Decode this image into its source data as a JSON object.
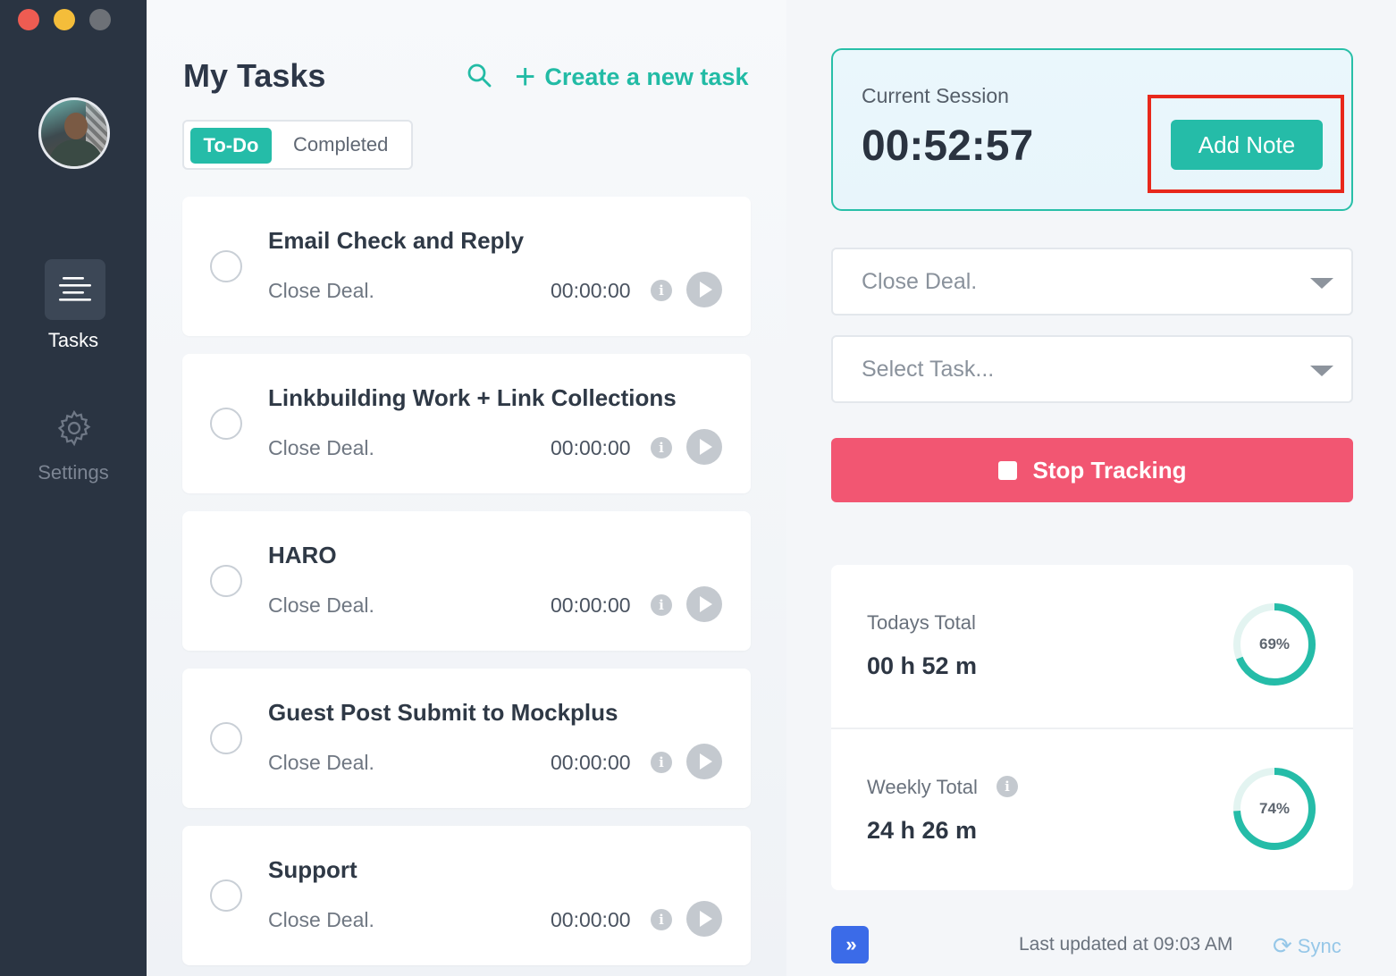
{
  "sidebar": {
    "nav": [
      {
        "label": "Tasks",
        "icon": "list-icon",
        "active": true
      },
      {
        "label": "Settings",
        "icon": "gear-icon",
        "active": false
      }
    ]
  },
  "tasks_panel": {
    "title": "My Tasks",
    "create_label": "Create a new task",
    "tabs": {
      "todo": "To-Do",
      "completed": "Completed"
    },
    "tasks": [
      {
        "name": "Email Check and Reply",
        "project": "Close Deal.",
        "time": "00:00:00"
      },
      {
        "name": "Linkbuilding Work + Link Collections",
        "project": "Close Deal.",
        "time": "00:00:00"
      },
      {
        "name": "HARO",
        "project": "Close Deal.",
        "time": "00:00:00"
      },
      {
        "name": "Guest Post Submit to Mockplus",
        "project": "Close Deal.",
        "time": "00:00:00"
      },
      {
        "name": "Support",
        "project": "Close Deal.",
        "time": "00:00:00"
      }
    ]
  },
  "session": {
    "label": "Current Session",
    "time": "00:52:57",
    "add_note": "Add Note"
  },
  "selects": {
    "project": "Close Deal.",
    "task_placeholder": "Select Task..."
  },
  "stop_label": "Stop Tracking",
  "totals": {
    "today": {
      "label": "Todays Total",
      "value": "00 h 52 m",
      "percent_label": "69%",
      "percent": 69
    },
    "weekly": {
      "label": "Weekly Total",
      "value": "24 h 26 m",
      "percent_label": "74%",
      "percent": 74
    }
  },
  "footer": {
    "last_updated": "Last updated at 09:03 AM",
    "sync": "Sync",
    "expand_glyph": "»"
  },
  "colors": {
    "accent": "#25bca8",
    "danger": "#f25672",
    "sidebar": "#2a3442",
    "highlight": "#e8281b"
  }
}
